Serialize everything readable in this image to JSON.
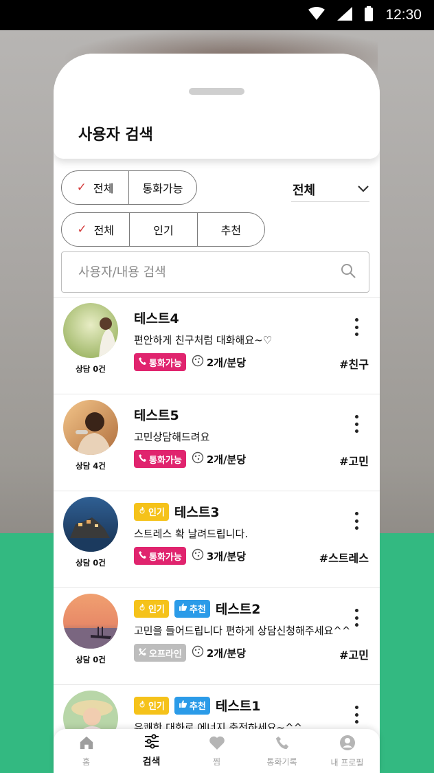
{
  "status_bar": {
    "time": "12:30"
  },
  "page": {
    "title": "사용자 검색"
  },
  "filters": {
    "availability": [
      {
        "label": "전체",
        "selected": true
      },
      {
        "label": "통화가능",
        "selected": false
      }
    ],
    "sort": [
      {
        "label": "전체",
        "selected": true
      },
      {
        "label": "인기",
        "selected": false
      },
      {
        "label": "추천",
        "selected": false
      }
    ],
    "dropdown": {
      "value": "전체"
    }
  },
  "search": {
    "placeholder": "사용자/내용 검색",
    "value": ""
  },
  "users": [
    {
      "name": "테스트4",
      "description": "편안하게 친구처럼 대화해요~♡",
      "consult": "상담 0건",
      "status": "통화가능",
      "price": "2개/분당",
      "tag": "#친구",
      "hot": false,
      "recommended": false
    },
    {
      "name": "테스트5",
      "description": "고민상담해드려요",
      "consult": "상담 4건",
      "status": "통화가능",
      "price": "2개/분당",
      "tag": "#고민",
      "hot": false,
      "recommended": false
    },
    {
      "name": "테스트3",
      "description": "스트레스 확 날려드립니다.",
      "consult": "상담 0건",
      "status": "통화가능",
      "price": "3개/분당",
      "tag": "#스트레스",
      "hot": true,
      "recommended": false
    },
    {
      "name": "테스트2",
      "description": "고민을 들어드립니다 편하게 상담신청해주세요^^",
      "consult": "상담 0건",
      "status": "오프라인",
      "price": "2개/분당",
      "tag": "#고민",
      "hot": true,
      "recommended": true
    },
    {
      "name": "테스트1",
      "description": "유쾌한 대화로 에너지 충전하세요~^^",
      "consult": "",
      "status": "",
      "price": "",
      "tag": "",
      "hot": true,
      "recommended": true
    }
  ],
  "badges": {
    "hot": "인기",
    "recommended": "추천"
  },
  "bottom_nav": [
    {
      "label": "홈",
      "icon": "home-icon",
      "active": false
    },
    {
      "label": "검색",
      "icon": "search-filter-icon",
      "active": true
    },
    {
      "label": "찜",
      "icon": "heart-icon",
      "active": false
    },
    {
      "label": "통화기록",
      "icon": "phone-icon",
      "active": false
    },
    {
      "label": "내 프로필",
      "icon": "profile-icon",
      "active": false
    }
  ],
  "colors": {
    "accent_green": "#33b981",
    "call_badge": "#e0246e",
    "hot_badge": "#f5c21a",
    "rec_badge": "#2b9be8",
    "offline_badge": "#bdbdbd"
  }
}
